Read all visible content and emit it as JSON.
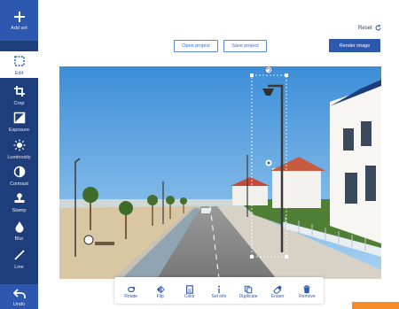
{
  "sidebar": {
    "add_set": "Add set",
    "items": [
      {
        "label": "Edit",
        "icon": "selection-icon"
      },
      {
        "label": "Crop",
        "icon": "crop-icon"
      },
      {
        "label": "Exposure",
        "icon": "exposure-icon"
      },
      {
        "label": "Luminosity",
        "icon": "sun-icon"
      },
      {
        "label": "Contrast",
        "icon": "contrast-icon"
      },
      {
        "label": "Stamp",
        "icon": "stamp-icon"
      },
      {
        "label": "Blur",
        "icon": "drop-icon"
      },
      {
        "label": "Line",
        "icon": "line-icon"
      }
    ],
    "undo": "Undo"
  },
  "header": {
    "open_project": "Open project",
    "save_project": "Save project",
    "render_image": "Render image",
    "reset": "Reset"
  },
  "toolbar": {
    "items": [
      {
        "label": "Rotate",
        "icon": "rotate-icon"
      },
      {
        "label": "Flip",
        "icon": "flip-icon"
      },
      {
        "label": "Color",
        "icon": "color-icon"
      },
      {
        "label": "Set info",
        "icon": "info-icon"
      },
      {
        "label": "Duplicate",
        "icon": "duplicate-icon"
      },
      {
        "label": "Eraser",
        "icon": "eraser-icon"
      },
      {
        "label": "Remove",
        "icon": "trash-icon"
      }
    ]
  },
  "colors": {
    "sidebar": "#1e3d7b",
    "accent": "#2d58b0",
    "orange": "#f28c28"
  }
}
